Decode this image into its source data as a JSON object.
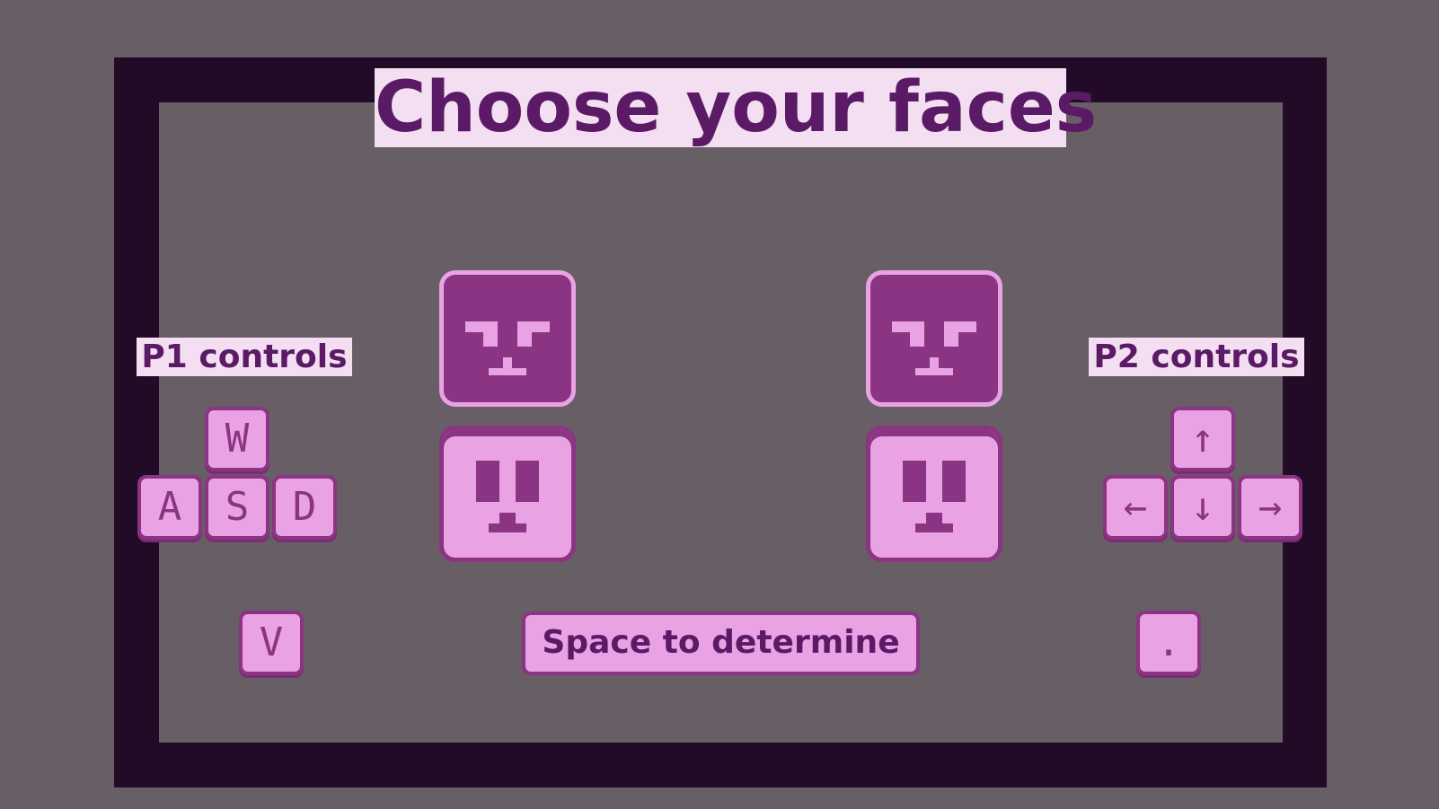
{
  "title": "Choose your faces",
  "p1": {
    "label": "P1 controls",
    "keys": {
      "up": "W",
      "left": "A",
      "down": "S",
      "right": "D",
      "action": "V"
    }
  },
  "p2": {
    "label": "P2 controls",
    "keys": {
      "up": "↑",
      "left": "←",
      "down": "↓",
      "right": "→",
      "action": "."
    }
  },
  "space_label": "Space to determine",
  "faces": {
    "top_style": "angry-face-icon",
    "bottom_style": "neutral-face-icon"
  },
  "colors": {
    "background": "#675e66",
    "frame": "#220b26",
    "title_bg": "#f3dff1",
    "text": "#5a1a66",
    "key_fill": "#e9a3e4",
    "key_border": "#8a3483"
  }
}
